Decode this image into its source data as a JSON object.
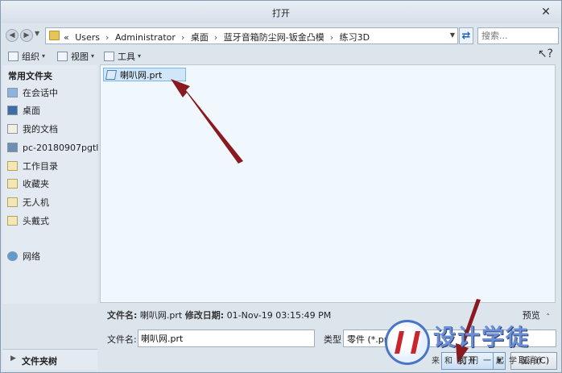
{
  "window": {
    "title": "打开"
  },
  "address": {
    "prefix": "«",
    "crumbs": [
      "Users",
      "Administrator",
      "桌面",
      "蓝牙音箱防尘网-钣金凸模",
      "练习3D"
    ],
    "search_placeholder": "搜索..."
  },
  "toolbar": {
    "organize": "组织",
    "view": "视图",
    "tools": "工具"
  },
  "sidebar": {
    "header": "常用文件夹",
    "items": [
      {
        "label": "在会话中",
        "icon": "session-icon"
      },
      {
        "label": "桌面",
        "icon": "desktop-icon"
      },
      {
        "label": "我的文档",
        "icon": "documents-icon"
      },
      {
        "label": "pc-20180907pgtl",
        "icon": "computer-icon"
      },
      {
        "label": "工作目录",
        "icon": "working-dir-icon"
      },
      {
        "label": "收藏夹",
        "icon": "favorites-icon"
      },
      {
        "label": "无人机",
        "icon": "folder-icon"
      },
      {
        "label": "头戴式",
        "icon": "folder-icon"
      },
      {
        "label": "网络",
        "icon": "network-icon"
      }
    ],
    "folder_tree": "文件夹树"
  },
  "files": [
    {
      "name": "喇叭网.prt",
      "selected": true
    }
  ],
  "details": {
    "name_key": "文件名:",
    "name_value": "喇叭网.prt",
    "date_key": "修改日期:",
    "date_value": "01-Nov-19 03:15:49 PM",
    "preview": "预览"
  },
  "form": {
    "filename_label": "文件名:",
    "filename_value": "喇叭网.prt",
    "type_label": "类型",
    "type_value": "零件 (*.prt)",
    "open_label": "打开",
    "cancel_label": "取消(C)"
  },
  "watermark": {
    "text": "设计学徒",
    "sub": "来和我们一起学设计"
  },
  "colors": {
    "annotation_arrow": "#8a1a1f",
    "selection": "#cfe7f9"
  }
}
